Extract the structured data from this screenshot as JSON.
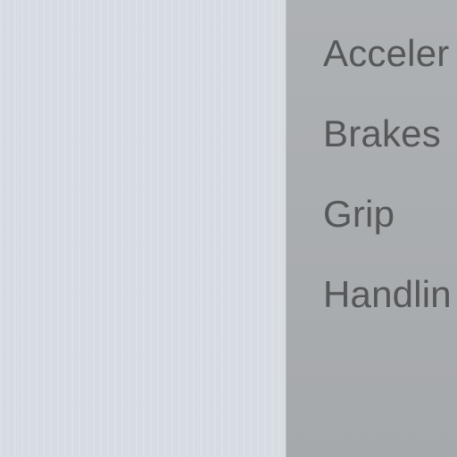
{
  "stats_panel": {
    "items": [
      {
        "label": "Acceler"
      },
      {
        "label": "Brakes"
      },
      {
        "label": "Grip"
      },
      {
        "label": "Handlin"
      }
    ]
  }
}
